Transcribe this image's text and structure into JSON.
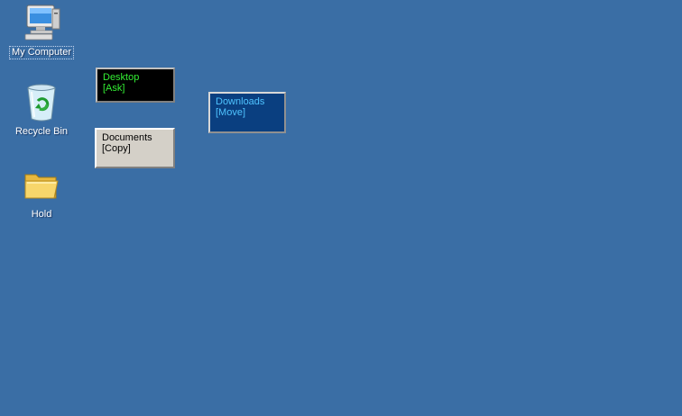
{
  "desktop": {
    "background": "#3a6ea5",
    "icons": [
      {
        "label": "My Computer",
        "icon": "my-computer-icon",
        "selected": true
      },
      {
        "label": "Recycle Bin",
        "icon": "recycle-bin-icon",
        "selected": false
      },
      {
        "label": "Hold",
        "icon": "folder-icon",
        "selected": false
      }
    ],
    "tiles": [
      {
        "name": "Desktop",
        "action": "[Ask]",
        "background": "#000000",
        "text_color": "#33ee33"
      },
      {
        "name": "Documents",
        "action": "[Copy]",
        "background": "#d4d0c8",
        "text_color": "#000000"
      },
      {
        "name": "Downloads",
        "action": "[Move]",
        "background": "#0a3f80",
        "text_color": "#4fc3ff"
      }
    ]
  }
}
